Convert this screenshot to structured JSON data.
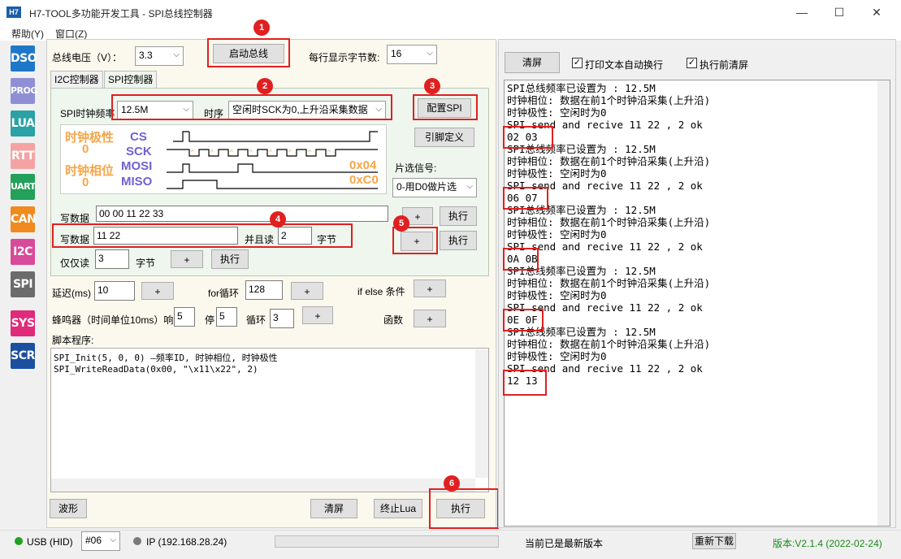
{
  "window": {
    "icon_text": "H7",
    "title": "H7-TOOL多功能开发工具 - SPI总线控制器",
    "minimize": "—",
    "maximize": "☐",
    "close": "✕"
  },
  "menu": [
    "帮助(Y)",
    "窗口(Z)"
  ],
  "sidebar": [
    {
      "label": "DSO",
      "color": "#1e78c8"
    },
    {
      "label": "PROG",
      "color": "#8f8fd6"
    },
    {
      "label": "LUA",
      "color": "#2aa2a6"
    },
    {
      "label": "RTT",
      "color": "#f4a3a3"
    },
    {
      "label": "UART",
      "color": "#23a05a"
    },
    {
      "label": "CAN",
      "color": "#f08a1e"
    },
    {
      "label": "I2C",
      "color": "#d84a9a"
    },
    {
      "label": "SPI",
      "color": "#6b6b6b"
    },
    {
      "label": "SYS",
      "color": "#e02a7a"
    },
    {
      "label": "SCR",
      "color": "#1c4fa0"
    }
  ],
  "top": {
    "voltage_label": "总线电压（V）：",
    "voltage_value": "3.3",
    "start_bus": "启动总线",
    "bytes_per_line_label": "每行显示字节数:",
    "bytes_per_line_value": "16"
  },
  "tabs": [
    "I2C控制器",
    "SPI控制器"
  ],
  "spi": {
    "clock_label": "SPI时钟频率",
    "clock_value": "12.5M",
    "timing_label": "时序",
    "timing_value": "空闲时SCK为0,上升沿采集数据",
    "config_btn": "配置SPI",
    "pin_btn": "引脚定义",
    "cs_label": "片选信号:",
    "cs_value": "0-用D0做片选",
    "diagram": {
      "cpol_label": "时钟极性",
      "cpol_value": "0",
      "cpha_label": "时钟相位",
      "cpha_value": "0",
      "signals": [
        "CS",
        "SCK",
        "MOSI",
        "MISO"
      ],
      "mosi_hex": "0x04",
      "miso_hex": "0xC0"
    },
    "write_label": "写数据",
    "write_value": "00 00 11 22 33",
    "write_read_label": "写数据",
    "write_read_value": "11 22",
    "and_read_label": "并且读",
    "and_read_value": "2",
    "bytes_unit": "字节",
    "read_only_label": "仅仅读",
    "read_only_value": "3",
    "plus": "+",
    "exec": "执行"
  },
  "script": {
    "delay_label": "延迟(ms)",
    "delay_value": "10",
    "for_label": "for循环",
    "for_value": "128",
    "ifelse_label": "if else 条件",
    "buzzer_label": "蜂鸣器（时间单位10ms）响",
    "buzzer_on": "5",
    "stop_label": "停",
    "stop_value": "5",
    "loop_label": "循环",
    "loop_value": "3",
    "func_label": "函数",
    "program_label": "脚本程序:",
    "lines": [
      "SPI_Init(5, 0, 0) —频率ID, 时钟相位, 时钟极性",
      "SPI_WriteReadData(0x00, \"\\x11\\x22\", 2)"
    ],
    "wave_btn": "波形",
    "clear_btn": "清屏",
    "stop_lua_btn": "终止Lua",
    "exec_btn": "执行"
  },
  "right": {
    "clear_btn": "清屏",
    "wrap_label": "打印文本自动换行",
    "clear_before_label": "执行前清屏",
    "log": [
      "SPI总线频率已设置为 : 12.5M",
      "时钟相位: 数据在前1个时钟沿采集(上升沿)",
      "时钟极性: 空闲时为0",
      "SPI send and recive 11 22 , 2 ok",
      "02 03",
      "SPI总线频率已设置为 : 12.5M",
      "时钟相位: 数据在前1个时钟沿采集(上升沿)",
      "时钟极性: 空闲时为0",
      "SPI send and recive 11 22 , 2 ok",
      "06 07",
      "SPI总线频率已设置为 : 12.5M",
      "时钟相位: 数据在前1个时钟沿采集(上升沿)",
      "时钟极性: 空闲时为0",
      "SPI send and recive 11 22 , 2 ok",
      "0A 0B",
      "SPI总线频率已设置为 : 12.5M",
      "时钟相位: 数据在前1个时钟沿采集(上升沿)",
      "时钟极性: 空闲时为0",
      "SPI send and recive 11 22 , 2 ok",
      "0E 0F",
      "SPI总线频率已设置为 : 12.5M",
      "时钟相位: 数据在前1个时钟沿采集(上升沿)",
      "时钟极性: 空闲时为0",
      "SPI send and recive 11 22 , 2 ok",
      "12 13"
    ]
  },
  "badges": [
    "1",
    "2",
    "3",
    "4",
    "5",
    "6"
  ],
  "status": {
    "usb": "USB (HID)",
    "device": "#06",
    "ip": "IP (192.168.28.24)",
    "latest": "当前已是最新版本",
    "redownload": "重新下载",
    "version": "版本:V2.1.4 (2022-02-24)"
  }
}
